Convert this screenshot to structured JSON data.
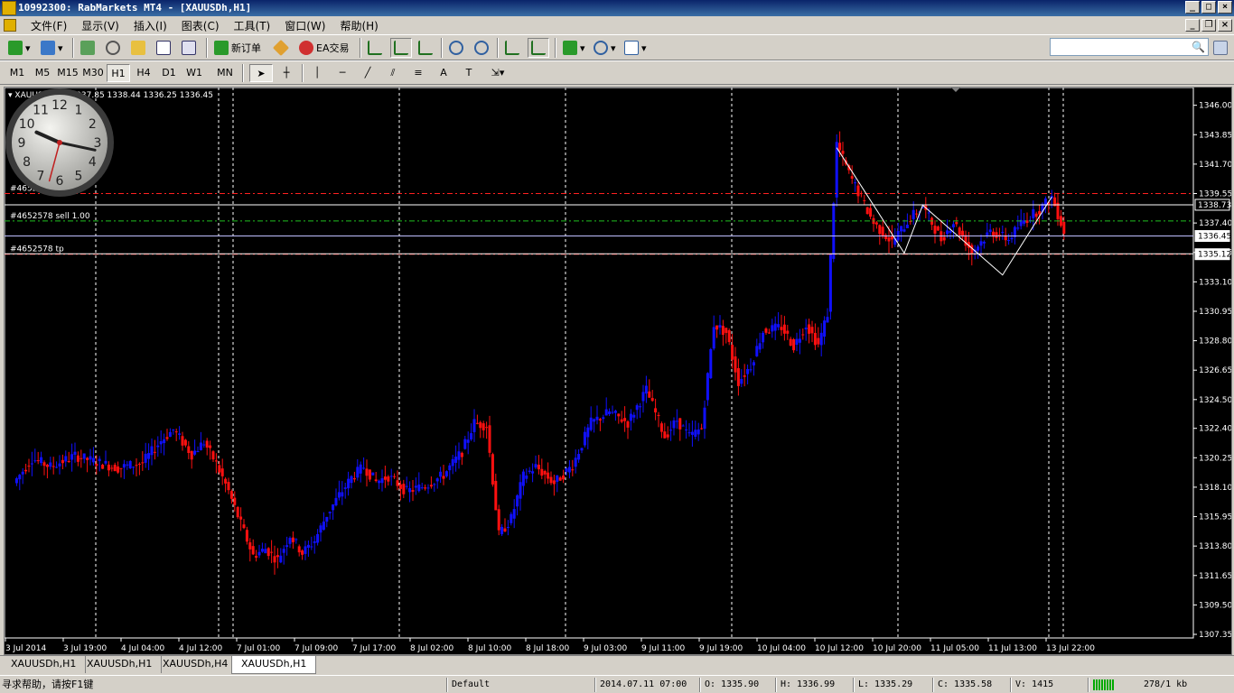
{
  "window": {
    "title": "10992300: RabMarkets MT4 - [XAUUSDh,H1]"
  },
  "menu": [
    "文件(F)",
    "显示(V)",
    "插入(I)",
    "图表(C)",
    "工具(T)",
    "窗口(W)",
    "帮助(H)"
  ],
  "toolbar": {
    "new_order_label": "新订单",
    "ea_label": "EA交易"
  },
  "timeframes": [
    "M1",
    "M5",
    "M15",
    "M30",
    "H1",
    "H4",
    "D1",
    "W1",
    "MN"
  ],
  "active_timeframe": "H1",
  "search": {
    "placeholder": ""
  },
  "chart_data": {
    "type": "candlestick",
    "symbol_info": "XAUUSDh,H1  1337.85 1338.44 1336.25 1336.45",
    "ylim": [
      1307.35,
      1346.9
    ],
    "yticks": [
      "1346.00",
      "1343.85",
      "1341.70",
      "1339.55",
      "1337.40",
      "1335.25",
      "1333.10",
      "1330.95",
      "1328.80",
      "1326.65",
      "1324.50",
      "1322.40",
      "1320.25",
      "1318.10",
      "1315.95",
      "1313.80",
      "1311.65",
      "1309.50",
      "1307.35"
    ],
    "xticks": [
      "3 Jul 2014",
      "3 Jul 19:00",
      "4 Jul 04:00",
      "4 Jul 12:00",
      "7 Jul 01:00",
      "7 Jul 09:00",
      "7 Jul 17:00",
      "8 Jul 02:00",
      "8 Jul 10:00",
      "8 Jul 18:00",
      "9 Jul 03:00",
      "9 Jul 11:00",
      "9 Jul 19:00",
      "10 Jul 04:00",
      "10 Jul 12:00",
      "10 Jul 20:00",
      "11 Jul 05:00",
      "11 Jul 13:00",
      "13 Jul 22:00"
    ],
    "price_boxes": [
      {
        "value": "1338.73",
        "bg": "#000000",
        "fg": "#ffffff"
      },
      {
        "value": "1336.45",
        "bg": "#ffffff",
        "fg": "#000000"
      },
      {
        "value": "1335.12",
        "bg": "#ffffff",
        "fg": "#000000"
      }
    ],
    "order_lines": [
      {
        "label": "#4652578 sl",
        "price": 1339.55,
        "color": "#ff2020",
        "dash": "6,3,2,3"
      },
      {
        "label": "#4652578 sell 1.00",
        "price": 1337.55,
        "color": "#20c020",
        "dash": "6,3,2,3"
      },
      {
        "label": "#4652578 tp",
        "price": 1335.12,
        "color": "#ff2020",
        "dash": "6,3,2,3"
      }
    ],
    "level_lines": [
      {
        "price": 1338.73,
        "color": "#ffffff"
      },
      {
        "price": 1336.45,
        "color": "#c0c0ff"
      },
      {
        "price": 1335.15,
        "color": "#ffffff"
      }
    ],
    "session_lines_x": [
      101,
      237,
      253,
      437,
      621,
      805,
      989,
      1156,
      1172
    ],
    "up_color": "#1010ff",
    "down_color": "#ff1010",
    "zigzag": [
      [
        1342.9,
        0
      ],
      [
        1335.2,
        1
      ],
      [
        1338.7,
        2
      ],
      [
        1333.6,
        3
      ],
      [
        1339.3,
        4
      ]
    ]
  },
  "tabs": [
    "XAUUSDh,H1",
    "XAUUSDh,H1",
    "XAUUSDh,H4",
    "XAUUSDh,H1"
  ],
  "active_tab": 3,
  "status": {
    "help": "寻求帮助，请按F1键",
    "profile": "Default",
    "datetime": "2014.07.11 07:00",
    "open": "O: 1335.90",
    "high": "H: 1336.99",
    "low": "L: 1335.29",
    "close": "C: 1335.58",
    "volume": "V: 1415",
    "traffic": "278/1 kb"
  },
  "clock": {
    "numerals": [
      "12",
      "1",
      "2",
      "3",
      "4",
      "5",
      "6",
      "7",
      "8",
      "9",
      "10",
      "11"
    ]
  }
}
